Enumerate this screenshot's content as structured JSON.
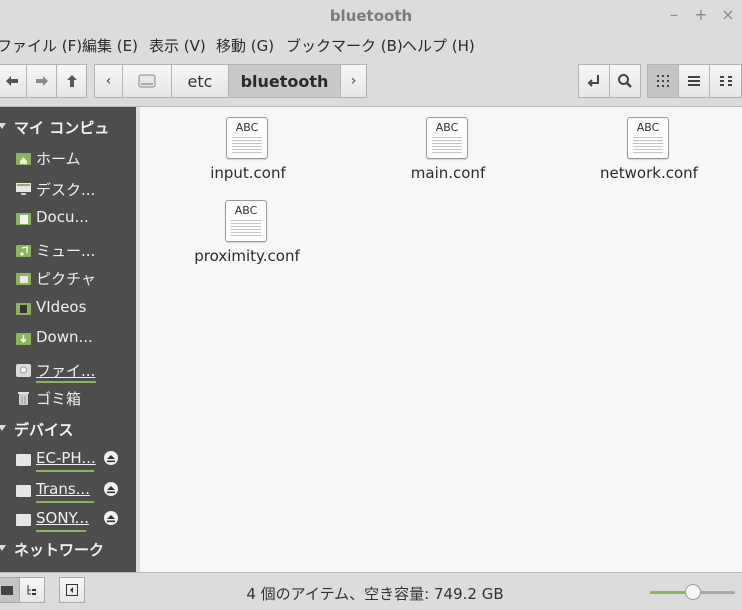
{
  "window": {
    "title": "bluetooth",
    "minimize": "–",
    "maximize": "+",
    "close": "×"
  },
  "menu": [
    "ファイル (F)",
    "編集 (E)",
    "表示 (V)",
    "移動 (G)",
    "ブックマーク (B)",
    "ヘルプ (H)"
  ],
  "toolbar": {
    "back_icon": "arrow-left-icon",
    "forward_icon": "arrow-right-icon",
    "up_icon": "arrow-up-icon",
    "path_prev": "‹",
    "path_next": "›",
    "breadcrumbs": [
      "etc",
      "bluetooth"
    ],
    "active_crumb": "bluetooth"
  },
  "sidebar": {
    "sections": [
      {
        "title": "マイ コンピュ"
      },
      {
        "title": "デバイス"
      },
      {
        "title": "ネットワーク"
      }
    ],
    "places": [
      {
        "label": "ホーム",
        "icon": "home-folder-icon"
      },
      {
        "label": "デスク...",
        "icon": "desktop-icon"
      },
      {
        "label": "Docu...",
        "icon": "documents-folder-icon"
      },
      {
        "label": "ミュー...",
        "icon": "music-folder-icon"
      },
      {
        "label": "ピクチャ",
        "icon": "pictures-folder-icon"
      },
      {
        "label": "VIdeos",
        "icon": "videos-folder-icon"
      },
      {
        "label": "Down...",
        "icon": "downloads-folder-icon"
      },
      {
        "label": "ファイ...",
        "icon": "filesystem-drive-icon"
      },
      {
        "label": "ゴミ箱",
        "icon": "trash-icon"
      }
    ],
    "devices": [
      {
        "label": "EC-PH...",
        "icon": "drive-icon"
      },
      {
        "label": "Trans...",
        "icon": "drive-icon"
      },
      {
        "label": "SONY...",
        "icon": "drive-icon"
      }
    ]
  },
  "files": [
    {
      "name": "input.conf",
      "icon_text": "ABC"
    },
    {
      "name": "main.conf",
      "icon_text": "ABC"
    },
    {
      "name": "network.conf",
      "icon_text": "ABC"
    },
    {
      "name": "proximity.conf",
      "icon_text": "ABC"
    }
  ],
  "status": {
    "text": "4 個のアイテム、空き容量: 749.2 GB",
    "zoom_level": 0.5
  },
  "colors": {
    "sidebar_bg": "#4d4d4d",
    "accent": "#8fb35a",
    "content_bg": "#f7f7f7"
  }
}
